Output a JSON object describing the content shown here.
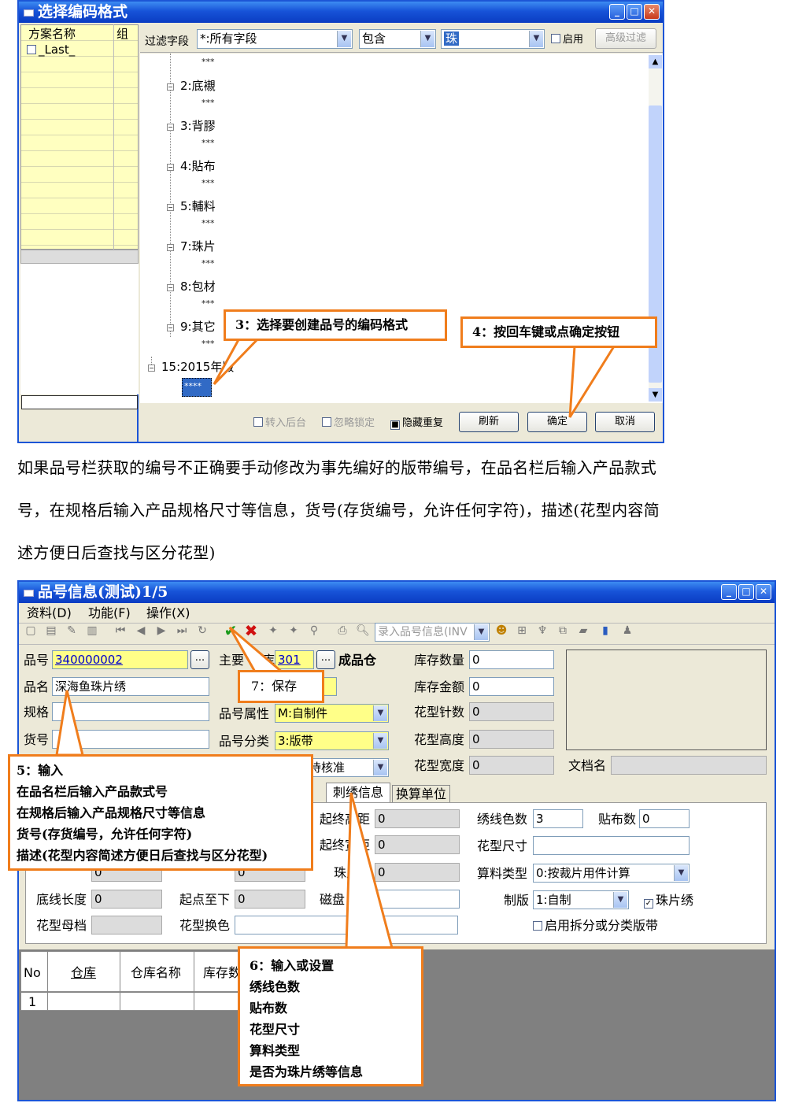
{
  "dialog1": {
    "title": "选择编码格式",
    "left_panel": {
      "col1": "方案名称",
      "col2": "组",
      "row1": "_Last_"
    },
    "filter": {
      "label": "过滤字段",
      "field_value": "*:所有字段",
      "op_value": "包含",
      "keyword": "珠",
      "enable_label": "启用",
      "adv_button": "高级过滤"
    },
    "tree": {
      "leaf_mark": "***",
      "nodes": [
        "2:底襯",
        "3:背膠",
        "4:貼布",
        "5:輔料",
        "7:珠片",
        "8:包材",
        "9:其它"
      ],
      "root": "15:2015年版",
      "selected": "****"
    },
    "bottom": {
      "chk_backend": "转入后台",
      "chk_ignore": "忽略锁定",
      "chk_hide": "隐藏重复",
      "refresh": "刷新",
      "ok": "确定",
      "cancel": "取消"
    },
    "callouts": {
      "c3": "3：选择要创建品号的编码格式",
      "c4": "4：按回车键或点确定按钮"
    }
  },
  "paragraph": [
    "如果品号栏获取的编号不正确要手动修改为事先编好的版带编号，在品名栏后输入产品款式",
    "号，在规格后输入产品规格尺寸等信息，货号(存货编号，允许任何字符)，描述(花型内容简",
    "述方便日后查找与区分花型)"
  ],
  "dialog2": {
    "title": "品号信息(测试)1/5",
    "menu": [
      "资料(D)",
      "功能(F)",
      "操作(X)"
    ],
    "toolbar_combo": "录入品号信息(INV",
    "fields": {
      "item_no_label": "品号",
      "item_no": "340000002",
      "name_label": "品名",
      "name": "深海鱼珠片绣",
      "spec_label": "规格",
      "spec": "",
      "goods_label": "货号",
      "main_wh_label": "主要",
      "main_wh_label2": "库",
      "main_wh": "301",
      "main_wh_name": "成品仓",
      "attr_label": "品号属性",
      "attr": "M:自制件",
      "cat_label": "品号分类",
      "cat": "3:版带",
      "status_tail": "待核准",
      "stock_qty_label": "库存数量",
      "stock_qty": "0",
      "stock_amt_label": "库存金额",
      "stock_amt": "0",
      "stitches_label": "花型针数",
      "stitches": "0",
      "height_label": "花型高度",
      "height": "0",
      "width_label": "花型宽度",
      "width": "0",
      "doc_label": "文档名"
    },
    "tabs": [
      "刺绣信息",
      "换算单位"
    ],
    "embroidery": {
      "thread_colors_label": "绣线色数",
      "thread_colors": "3",
      "patches_label": "贴布数",
      "patches": "0",
      "size_label": "花型尺寸",
      "size": "",
      "calc_label": "算料类型",
      "calc": "0:按裁片用件计算",
      "plate_label": "制版",
      "plate": "1:自制",
      "sequin_label": "珠片绣",
      "split_label": "启用拆分或分类版带",
      "start_end1": "起终高距",
      "v1": "0",
      "start_end2": "起终宽距",
      "v2": "0",
      "sequin_short": "珠片",
      "v3": "0",
      "disk_label": "磁盘",
      "baseline_len_label": "底线长度",
      "baseline_len": "0",
      "start_tb_label": "起点至下",
      "start_tb": "0",
      "face_len": "0",
      "start_top": "0",
      "master_label": "花型母档",
      "swap_label": "花型换色"
    },
    "grid": {
      "headers": [
        "No",
        "仓库",
        "仓库名称",
        "库存数"
      ],
      "row1": "1"
    },
    "callouts": {
      "c5": [
        "5：输入",
        "在品名栏后输入产品款式号",
        "在规格后输入产品规格尺寸等信息",
        "货号(存货编号，允许任何字符)",
        "描述(花型内容简述方便日后查找与区分花型)"
      ],
      "c6": [
        "6：输入或设置",
        "绣线色数",
        "贴布数",
        "花型尺寸",
        "算料类型",
        "是否为珠片绣等信息"
      ],
      "c7": "7：保存"
    }
  }
}
